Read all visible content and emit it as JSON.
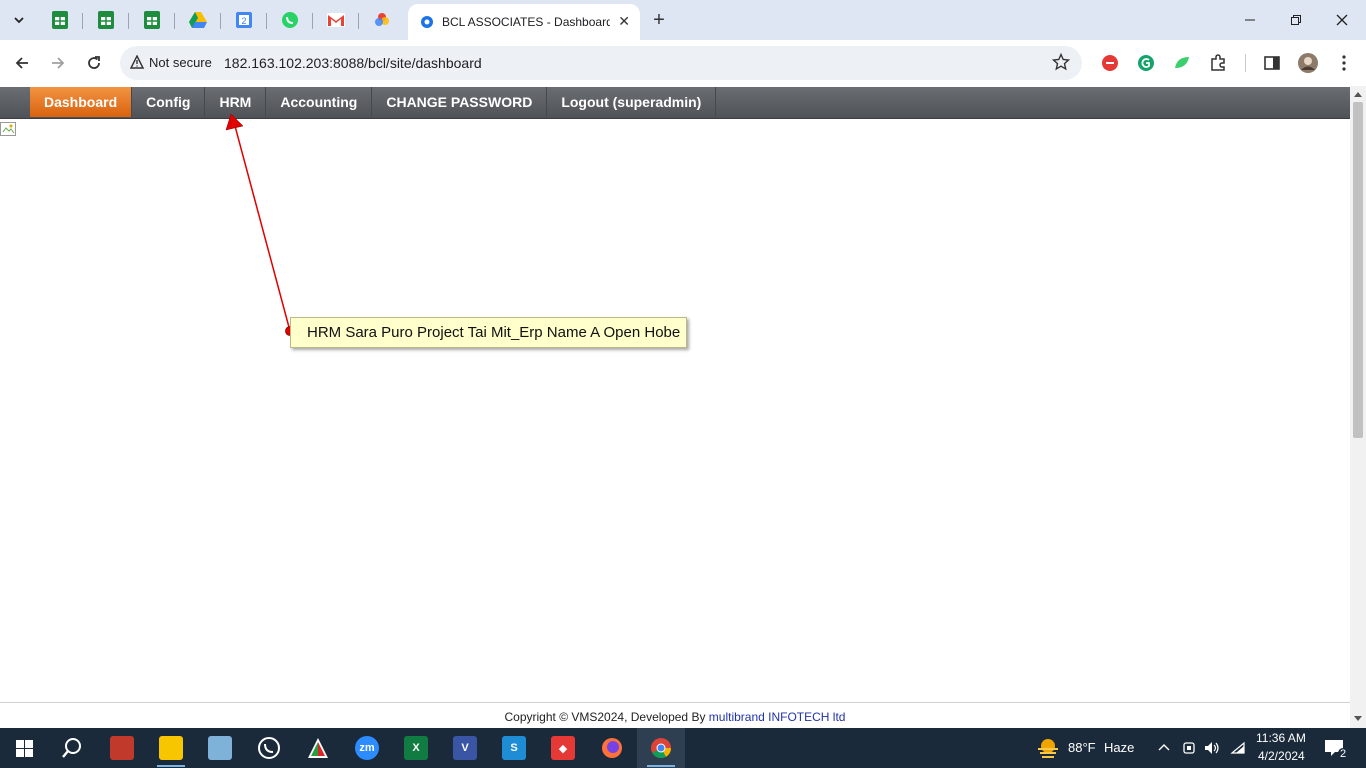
{
  "browser": {
    "pinned_tabs": [
      {
        "icon": "google-sheets-icon",
        "color": "#1e8e3e"
      },
      {
        "icon": "google-sheets-icon",
        "color": "#1e8e3e"
      },
      {
        "icon": "google-sheets-icon",
        "color": "#1e8e3e"
      },
      {
        "icon": "google-drive-icon",
        "color": "#fbbc04"
      },
      {
        "icon": "google-calendar-icon",
        "color": "#4285f4",
        "text": "2"
      },
      {
        "icon": "whatsapp-icon",
        "color": "#25d366"
      },
      {
        "icon": "gmail-icon",
        "color": "#ea4335"
      },
      {
        "icon": "google-photos-icon",
        "color": "#ea4335"
      }
    ],
    "active_tab_title": "BCL ASSOCIATES - Dashboard S",
    "security_label": "Not secure",
    "url": "182.163.102.203:8088/bcl/site/dashboard"
  },
  "menu": {
    "items": [
      {
        "label": "Dashboard",
        "active": true
      },
      {
        "label": "Config"
      },
      {
        "label": "HRM"
      },
      {
        "label": "Accounting"
      },
      {
        "label": "CHANGE PASSWORD"
      },
      {
        "label": "Logout (superadmin)"
      }
    ]
  },
  "annotation": {
    "text": "HRM Sara Puro Project Tai Mit_Erp Name A Open Hobe"
  },
  "footer": {
    "text": "Copyright © VMS2024, Developed By ",
    "link": "multibrand INFOTECH ltd"
  },
  "taskbar": {
    "weather_temp": "88°F",
    "weather_text": "Haze",
    "time": "11:36 AM",
    "date": "4/2/2024",
    "notification_count": "2"
  },
  "colors": {
    "menu_active": "#e8761f",
    "callout_bg": "#ffffcc",
    "arrow": "#e00000"
  }
}
